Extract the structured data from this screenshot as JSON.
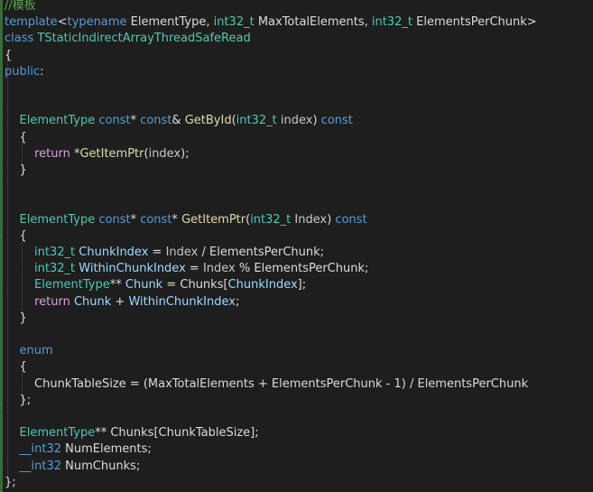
{
  "theme": {
    "background": "#1e1e1e",
    "keyword": "#569cd6",
    "type": "#4ec9b0",
    "function": "#dcdcaa",
    "member": "#c8c8c8",
    "param": "#9cdcfe",
    "comment": "#57a64a",
    "text": "#dcdcdc",
    "control": "#d8a0df",
    "gutter_bar": "#3a6a3a"
  },
  "lines": [
    {
      "tokens": [
        {
          "t": "//模板",
          "c": "comment"
        }
      ]
    },
    {
      "tokens": [
        {
          "t": "template",
          "c": "keyword"
        },
        {
          "t": "<",
          "c": "text"
        },
        {
          "t": "typename",
          "c": "keyword"
        },
        {
          "t": " ElementType, ",
          "c": "text"
        },
        {
          "t": "int32_t",
          "c": "type"
        },
        {
          "t": " MaxTotalElements, ",
          "c": "text"
        },
        {
          "t": "int32_t",
          "c": "type"
        },
        {
          "t": " ElementsPerChunk>",
          "c": "text"
        }
      ]
    },
    {
      "tokens": [
        {
          "t": "class",
          "c": "keyword"
        },
        {
          "t": " TStaticIndirectArrayThreadSafeRead",
          "c": "type"
        }
      ]
    },
    {
      "tokens": [
        {
          "t": "{",
          "c": "text"
        }
      ]
    },
    {
      "tokens": [
        {
          "t": "public",
          "c": "keyword"
        },
        {
          "t": ":",
          "c": "text"
        }
      ]
    },
    {
      "tokens": []
    },
    {
      "tokens": []
    },
    {
      "tokens": [
        {
          "t": "    ElementType",
          "c": "type"
        },
        {
          "t": " const",
          "c": "keyword"
        },
        {
          "t": "* ",
          "c": "text"
        },
        {
          "t": "const",
          "c": "keyword"
        },
        {
          "t": "& ",
          "c": "text"
        },
        {
          "t": "GetById",
          "c": "function"
        },
        {
          "t": "(",
          "c": "text"
        },
        {
          "t": "int32_t",
          "c": "type"
        },
        {
          "t": " index",
          "c": "member"
        },
        {
          "t": ") ",
          "c": "text"
        },
        {
          "t": "const",
          "c": "keyword"
        }
      ]
    },
    {
      "tokens": [
        {
          "t": "    {",
          "c": "text"
        }
      ]
    },
    {
      "tokens": [
        {
          "t": "        ",
          "c": "text"
        },
        {
          "t": "return",
          "c": "control"
        },
        {
          "t": " *",
          "c": "text"
        },
        {
          "t": "GetItemPtr",
          "c": "function"
        },
        {
          "t": "(",
          "c": "text"
        },
        {
          "t": "index",
          "c": "member"
        },
        {
          "t": ");",
          "c": "text"
        }
      ]
    },
    {
      "tokens": [
        {
          "t": "    }",
          "c": "text"
        }
      ]
    },
    {
      "tokens": []
    },
    {
      "tokens": []
    },
    {
      "tokens": [
        {
          "t": "    ElementType",
          "c": "type"
        },
        {
          "t": " const",
          "c": "keyword"
        },
        {
          "t": "* ",
          "c": "text"
        },
        {
          "t": "const",
          "c": "keyword"
        },
        {
          "t": "* ",
          "c": "text"
        },
        {
          "t": "GetItemPtr",
          "c": "function"
        },
        {
          "t": "(",
          "c": "text"
        },
        {
          "t": "int32_t",
          "c": "type"
        },
        {
          "t": " Index",
          "c": "member"
        },
        {
          "t": ") ",
          "c": "text"
        },
        {
          "t": "const",
          "c": "keyword"
        }
      ]
    },
    {
      "tokens": [
        {
          "t": "    {",
          "c": "text"
        }
      ]
    },
    {
      "tokens": [
        {
          "t": "        int32_t",
          "c": "type"
        },
        {
          "t": " ChunkIndex",
          "c": "param"
        },
        {
          "t": " = ",
          "c": "text"
        },
        {
          "t": "Index",
          "c": "member"
        },
        {
          "t": " / ElementsPerChunk;",
          "c": "text"
        }
      ]
    },
    {
      "tokens": [
        {
          "t": "        int32_t",
          "c": "type"
        },
        {
          "t": " WithinChunkIndex",
          "c": "param"
        },
        {
          "t": " = ",
          "c": "text"
        },
        {
          "t": "Index",
          "c": "member"
        },
        {
          "t": " % ElementsPerChunk;",
          "c": "text"
        }
      ]
    },
    {
      "tokens": [
        {
          "t": "        ElementType",
          "c": "type"
        },
        {
          "t": "** ",
          "c": "text"
        },
        {
          "t": "Chunk",
          "c": "param"
        },
        {
          "t": " = Chunks[",
          "c": "text"
        },
        {
          "t": "ChunkIndex",
          "c": "param"
        },
        {
          "t": "];",
          "c": "text"
        }
      ]
    },
    {
      "tokens": [
        {
          "t": "        ",
          "c": "text"
        },
        {
          "t": "return",
          "c": "control"
        },
        {
          "t": " ",
          "c": "text"
        },
        {
          "t": "Chunk",
          "c": "param"
        },
        {
          "t": " + ",
          "c": "text"
        },
        {
          "t": "WithinChunkIndex",
          "c": "param"
        },
        {
          "t": ";",
          "c": "text"
        }
      ]
    },
    {
      "tokens": [
        {
          "t": "    }",
          "c": "text"
        }
      ]
    },
    {
      "tokens": []
    },
    {
      "tokens": [
        {
          "t": "    enum",
          "c": "keyword"
        }
      ]
    },
    {
      "tokens": [
        {
          "t": "    {",
          "c": "text"
        }
      ]
    },
    {
      "tokens": [
        {
          "t": "        ChunkTableSize = (MaxTotalElements + ElementsPerChunk - 1) / ElementsPerChunk",
          "c": "text"
        }
      ]
    },
    {
      "tokens": [
        {
          "t": "    };",
          "c": "text"
        }
      ]
    },
    {
      "tokens": []
    },
    {
      "tokens": [
        {
          "t": "    ElementType",
          "c": "type"
        },
        {
          "t": "** Chunks[ChunkTableSize];",
          "c": "text"
        }
      ]
    },
    {
      "tokens": [
        {
          "t": "    __int32",
          "c": "keyword"
        },
        {
          "t": " NumElements;",
          "c": "text"
        }
      ]
    },
    {
      "tokens": [
        {
          "t": "    __int32",
          "c": "keyword"
        },
        {
          "t": " NumChunks;",
          "c": "text"
        }
      ]
    },
    {
      "tokens": [
        {
          "t": "};",
          "c": "text"
        }
      ]
    }
  ]
}
